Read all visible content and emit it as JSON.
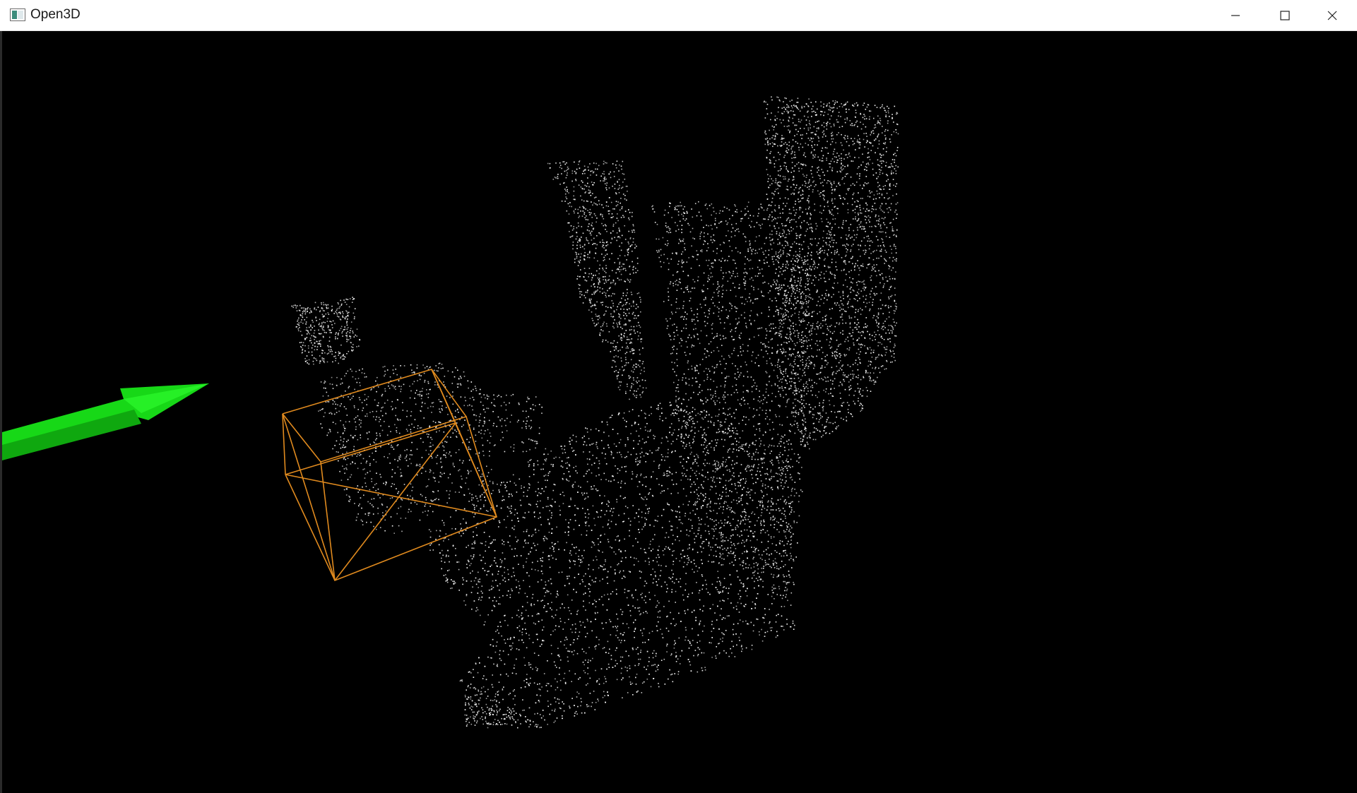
{
  "window": {
    "title": "Open3D",
    "icon": "open3d-app-icon",
    "controls": {
      "minimize_icon": "minimize-icon",
      "maximize_icon": "maximize-icon",
      "close_icon": "close-icon"
    }
  },
  "viewport": {
    "background_color": "#000000",
    "point_color": "#ffffff",
    "arrow_color": "#19e619",
    "bounding_box_color": "#e08a1e"
  }
}
